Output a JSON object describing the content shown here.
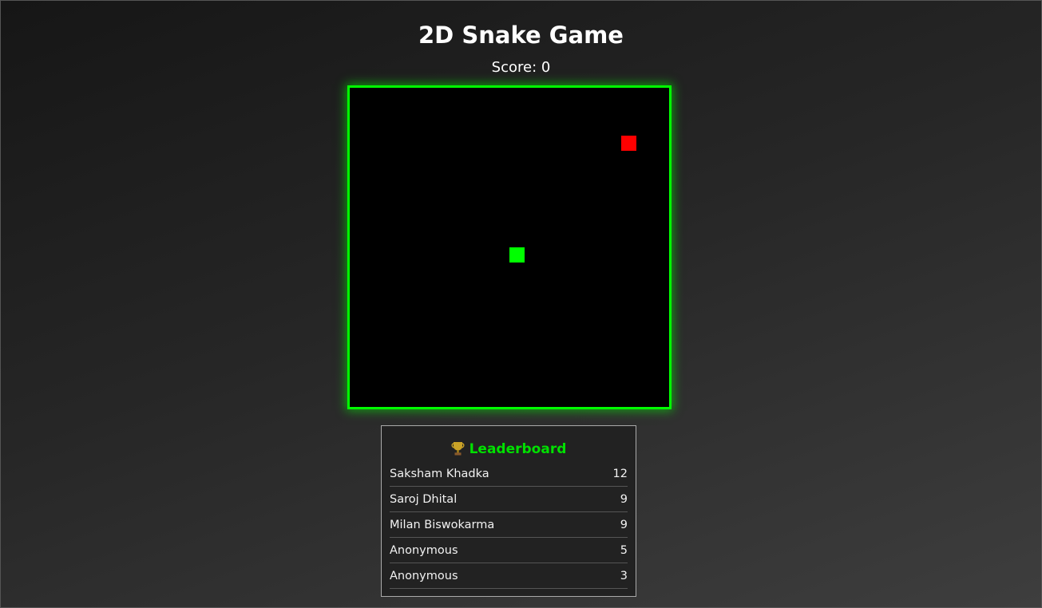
{
  "game": {
    "title": "2D Snake Game",
    "score_text": "Score: 0",
    "score": 0,
    "grid_size": 20,
    "food": {
      "col": 17,
      "row": 3
    },
    "snake": [
      {
        "col": 10,
        "row": 10
      }
    ],
    "colors": {
      "border": "#00ff00",
      "snake": "#00ff00",
      "food": "#ff0000",
      "background": "#000000"
    }
  },
  "leaderboard": {
    "icon": "trophy-icon",
    "title": "Leaderboard",
    "entries": [
      {
        "name": "Saksham Khadka",
        "score": "12"
      },
      {
        "name": "Saroj Dhital",
        "score": "9"
      },
      {
        "name": "Milan Biswokarma",
        "score": "9"
      },
      {
        "name": "Anonymous",
        "score": "5"
      },
      {
        "name": "Anonymous",
        "score": "3"
      }
    ]
  }
}
